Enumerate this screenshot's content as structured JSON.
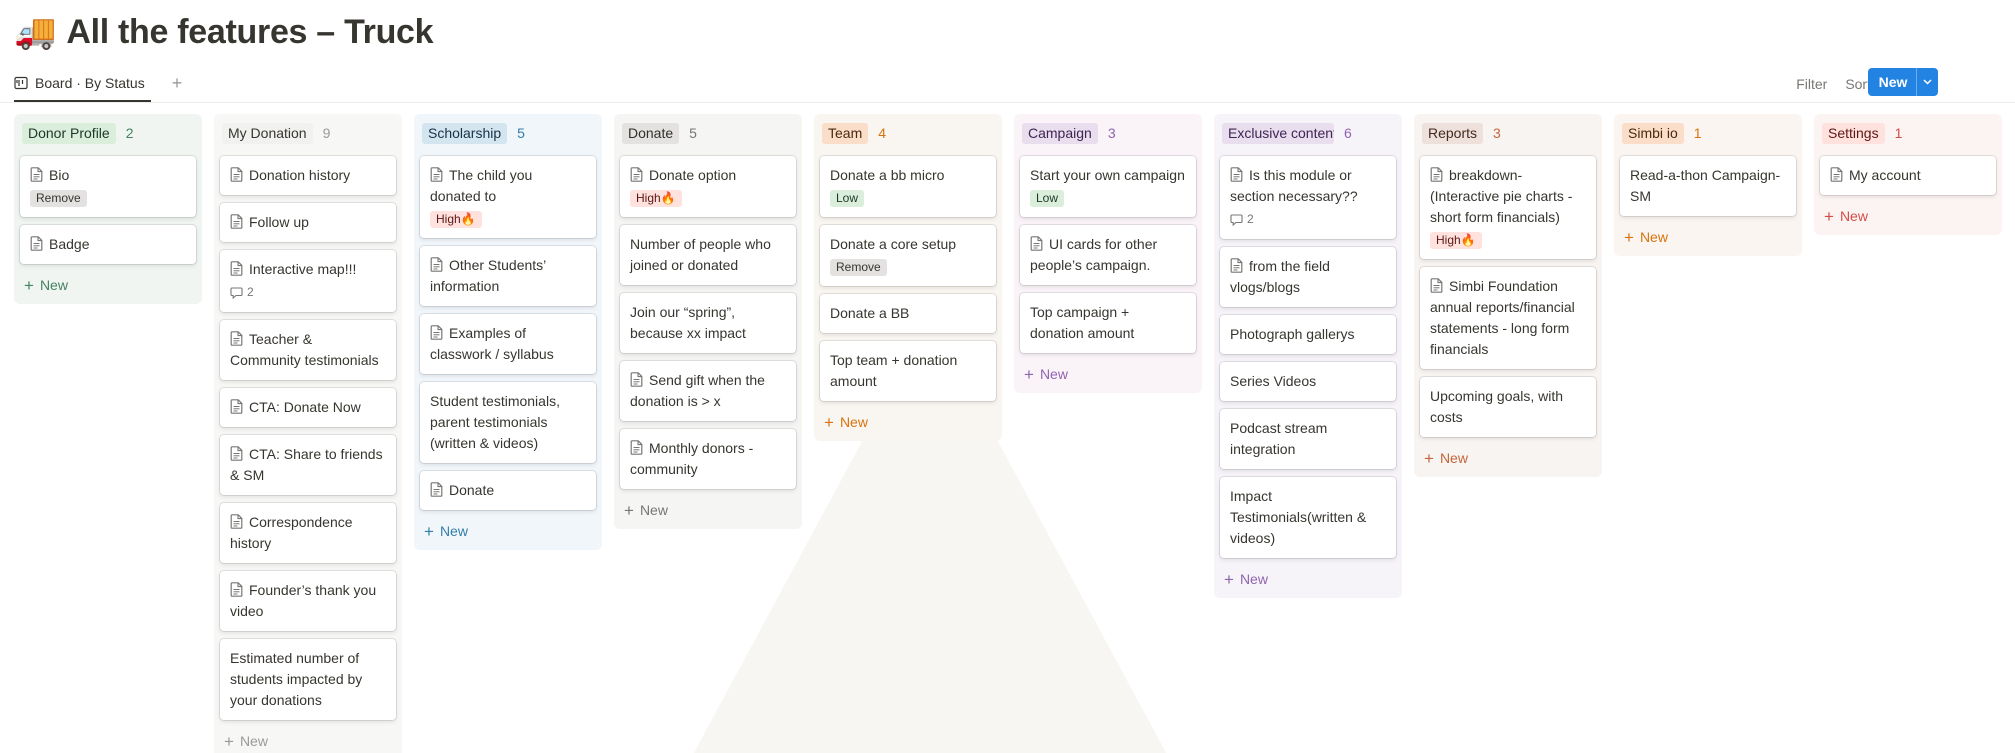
{
  "page": {
    "emoji": "🚚",
    "title": "All the features – Truck"
  },
  "viewbar": {
    "tab_label": "Board · By Status",
    "filter_label": "Filter",
    "sort_label": "Sort",
    "new_label": "New"
  },
  "board": {
    "new_card_label": "New",
    "columns": [
      {
        "name": "Donor Profile",
        "count": "2",
        "bg": "#f0f5f1",
        "chip_bg": "#dbeddb",
        "chip_color": "#1c3829",
        "accent": "#448361",
        "cards": [
          {
            "title": "Bio",
            "doc": true,
            "tag": "Remove",
            "tag_kind": "remove"
          },
          {
            "title": "Badge",
            "doc": true
          }
        ]
      },
      {
        "name": "My Donation",
        "count": "9",
        "bg": "#f7f7f5",
        "chip_bg": "#f1f1ef",
        "chip_color": "#37352f",
        "accent": "#9b9a97",
        "cards": [
          {
            "title": "Donation history",
            "doc": true
          },
          {
            "title": "Follow up",
            "doc": true
          },
          {
            "title": "Interactive map!!!",
            "doc": true,
            "comments": "2"
          },
          {
            "title": "Teacher & Community testimonials",
            "doc": true
          },
          {
            "title": "CTA: Donate Now",
            "doc": true
          },
          {
            "title": "CTA: Share to friends & SM",
            "doc": true
          },
          {
            "title": "Correspondence history",
            "doc": true
          },
          {
            "title": "Founder’s thank you video",
            "doc": true
          },
          {
            "title": "Estimated number of students impacted by your donations",
            "doc": false
          }
        ]
      },
      {
        "name": "Scholarship",
        "count": "5",
        "bg": "#f1f6fb",
        "chip_bg": "#d3e5ef",
        "chip_color": "#183347",
        "accent": "#337ea9",
        "cards": [
          {
            "title": "The child you donated to",
            "doc": true,
            "tag": "High🔥",
            "tag_kind": "high"
          },
          {
            "title": "Other Students’ information",
            "doc": true
          },
          {
            "title": "Examples of classwork / syllabus",
            "doc": true
          },
          {
            "title": "Student testimonials, parent testimonials (written & videos)",
            "doc": false
          },
          {
            "title": "Donate",
            "doc": true
          }
        ]
      },
      {
        "name": "Donate",
        "count": "5",
        "bg": "#f5f5f4",
        "chip_bg": "#e3e2e0",
        "chip_color": "#32302c",
        "accent": "#787774",
        "cards": [
          {
            "title": "Donate option",
            "doc": true,
            "tag": "High🔥",
            "tag_kind": "high"
          },
          {
            "title": "Number of people who joined or donated",
            "doc": false
          },
          {
            "title": "Join our “spring”, because xx impact",
            "doc": false
          },
          {
            "title": "Send gift when the donation is > x",
            "doc": true
          },
          {
            "title": "Monthly donors - community",
            "doc": true
          }
        ]
      },
      {
        "name": "Team",
        "count": "4",
        "bg": "#f9f6f1",
        "chip_bg": "#fadec9",
        "chip_color": "#49290e",
        "accent": "#d9730d",
        "cards": [
          {
            "title": "Donate a bb micro",
            "doc": false,
            "tag": "Low",
            "tag_kind": "low"
          },
          {
            "title": "Donate a core setup",
            "doc": false,
            "tag": "Remove",
            "tag_kind": "remove"
          },
          {
            "title": "Donate a BB",
            "doc": false
          },
          {
            "title": "Top team + donation amount",
            "doc": false
          }
        ]
      },
      {
        "name": "Campaign",
        "count": "3",
        "bg": "#faf3f8",
        "chip_bg": "#e8deee",
        "chip_color": "#412454",
        "accent": "#9065b0",
        "cards": [
          {
            "title": "Start your own campaign",
            "doc": false,
            "tag": "Low",
            "tag_kind": "low"
          },
          {
            "title": "UI cards for other people’s campaign.",
            "doc": true
          },
          {
            "title": "Top campaign + donation amount",
            "doc": false
          }
        ]
      },
      {
        "name": "Exclusive content",
        "count": "6",
        "bg": "#f6f3f9",
        "chip_bg": "#e8deee",
        "chip_color": "#412454",
        "accent": "#9065b0",
        "cards": [
          {
            "title": "Is this module or section necessary??",
            "doc": true,
            "comments": "2"
          },
          {
            "title": "from the field vlogs/blogs",
            "doc": true
          },
          {
            "title": "Photograph gallerys",
            "doc": false
          },
          {
            "title": "Series Videos",
            "doc": false
          },
          {
            "title": "Podcast stream integration",
            "doc": false
          },
          {
            "title": "Impact Testimonials(written & videos)",
            "doc": false
          }
        ]
      },
      {
        "name": "Reports",
        "count": "3",
        "bg": "#f8f4f1",
        "chip_bg": "#eee0da",
        "chip_color": "#442a1e",
        "accent": "#c4653d",
        "cards": [
          {
            "title": "breakdown- (Interactive pie charts - short form financials)",
            "doc": true,
            "tag": "High🔥",
            "tag_kind": "high"
          },
          {
            "title": "Simbi Foundation annual reports/financial statements - long form financials",
            "doc": true
          },
          {
            "title": "Upcoming goals, with costs",
            "doc": false
          }
        ]
      },
      {
        "name": "Simbi io",
        "count": "1",
        "bg": "#faf5f1",
        "chip_bg": "#fadec9",
        "chip_color": "#49290e",
        "accent": "#d9730d",
        "cards": [
          {
            "title": "Read-a-thon Campaign-SM",
            "doc": false
          }
        ]
      },
      {
        "name": "Settings",
        "count": "1",
        "bg": "#fcf4f2",
        "chip_bg": "#ffe2dd",
        "chip_color": "#5d1715",
        "accent": "#d44c47",
        "cards": [
          {
            "title": "My account",
            "doc": true
          }
        ]
      }
    ]
  }
}
